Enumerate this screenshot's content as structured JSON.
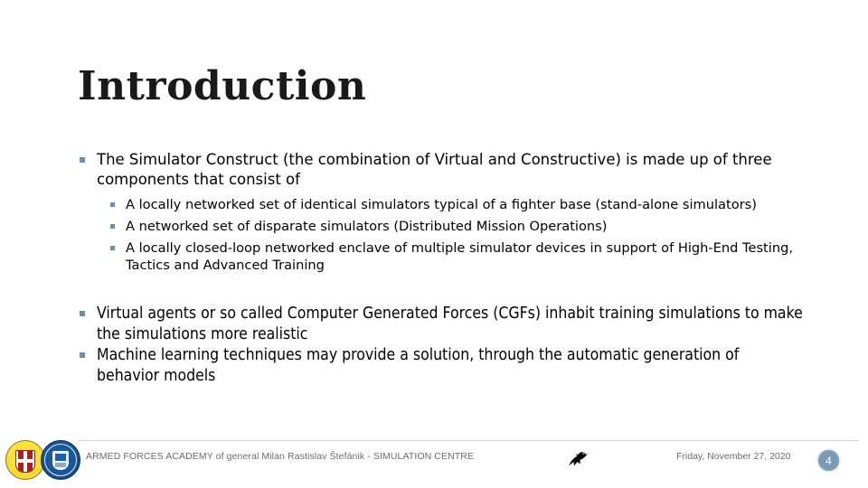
{
  "slide": {
    "title": "Introduction",
    "bullets": [
      {
        "level": 1,
        "text": "The Simulator Construct (the combination of Virtual and Constructive) is made up of three components that consist of"
      },
      {
        "level": 2,
        "text": "A locally networked set of identical simulators typical of a fighter base (stand-alone simulators)"
      },
      {
        "level": 2,
        "text": "A networked set of disparate simulators (Distributed Mission Operations)"
      },
      {
        "level": 2,
        "text": "A locally closed-loop networked enclave of multiple simulator devices in support of High-End Testing, Tactics and Advanced Training"
      },
      {
        "level": 1,
        "text": "Virtual agents or so called Computer Generated Forces (CGFs) inhabit training simulations to make the simulations more realistic"
      },
      {
        "level": 1,
        "text": "Machine learning techniques may provide a solution, through the automatic generation of behavior models"
      }
    ]
  },
  "footer": {
    "organization": "ARMED FORCES ACADEMY of general Milan Rastislav Štefánik - SIMULATION CENTRE",
    "date": "Friday, November 27, 2020",
    "page_number": "4",
    "center_icon": "bird-icon",
    "logo_left": "academy-gold-emblem",
    "logo_right": "simulation-centre-blue-emblem"
  },
  "colors": {
    "bullet_marker": "#6d8ea9",
    "footer_text": "#6b6b6b",
    "page_badge_bg": "#7c99b3",
    "rule": "#cfd8de"
  }
}
